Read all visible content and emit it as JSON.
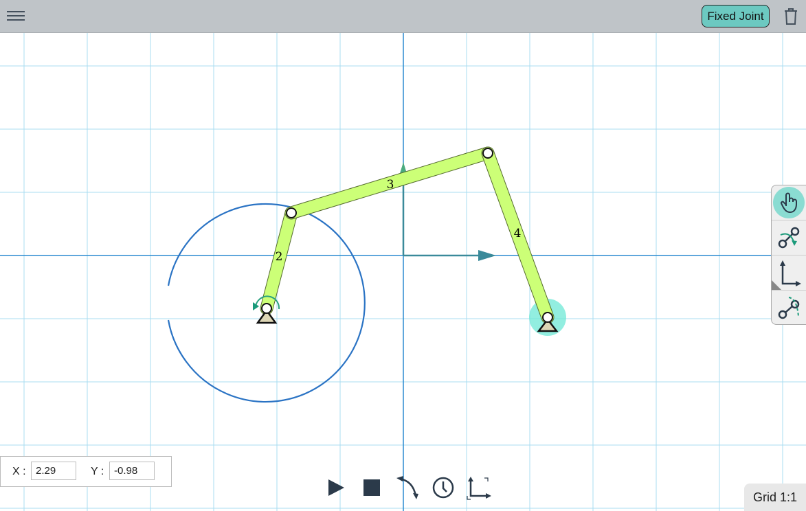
{
  "topbar": {
    "menu_icon": "hamburger-icon",
    "mode_button": "Fixed Joint",
    "delete_icon": "trash-icon"
  },
  "sidebar": {
    "tools": [
      {
        "name": "pan-select",
        "icon": "hand-pointer-icon",
        "active": true
      },
      {
        "name": "add-input",
        "icon": "rotation-input-icon"
      },
      {
        "name": "coordinate-frame",
        "icon": "axes-icon"
      },
      {
        "name": "path",
        "icon": "coupler-path-icon"
      }
    ]
  },
  "mechanism": {
    "links": [
      {
        "label": "2"
      },
      {
        "label": "3"
      },
      {
        "label": "4"
      }
    ],
    "link_color": "#ccff77",
    "path_color": "#2a73c4",
    "highlight_color": "#6ee8d6"
  },
  "coords": {
    "x_label": "X :",
    "x_value": "2.29",
    "y_label": "Y :",
    "y_value": "-0.98"
  },
  "controls": [
    {
      "name": "play",
      "icon": "play-icon"
    },
    {
      "name": "stop",
      "icon": "stop-icon"
    },
    {
      "name": "direction",
      "icon": "rotate-direction-icon"
    },
    {
      "name": "time",
      "icon": "clock-icon"
    },
    {
      "name": "origin",
      "icon": "axes-origin-icon"
    }
  ],
  "grid": {
    "label": "Grid 1:1"
  }
}
